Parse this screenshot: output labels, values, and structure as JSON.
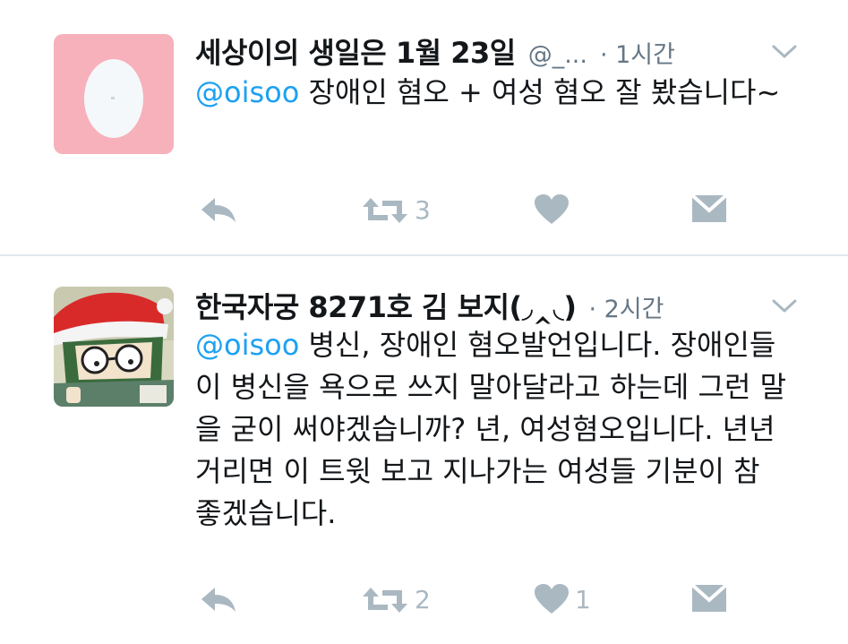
{
  "tweets": [
    {
      "name": "세상이의 생일은 1월 23일",
      "handle": "@_...",
      "time": "· 1시간",
      "mention": "@oisoo",
      "text": "장애인 혐오 + 여성 혐오 잘 봤습니다~",
      "retweets": "3",
      "likes": "",
      "avatar": "default-egg-avatar"
    },
    {
      "name": "한국자궁 8271호 김 보지(◞‸◟)",
      "handle": "",
      "time": "· 2시간",
      "mention": "@oisoo",
      "text": "병신, 장애인 혐오발언입니다. 장애인들이 병신을 욕으로 쓰지 말아달라고 하는데 그런 말을 굳이 써야겠습니까? 년, 여성혐오입니다. 년년 거리면 이 트윗 보고 지나가는 여성들 기분이 참 좋겠습니다.",
      "retweets": "2",
      "likes": "1",
      "avatar": "cartoon-santa-avatar"
    }
  ],
  "colors": {
    "link": "#1da1f2",
    "muted": "#657786",
    "icon": "#aab8c2",
    "egg_background": "#f7b1bb"
  }
}
